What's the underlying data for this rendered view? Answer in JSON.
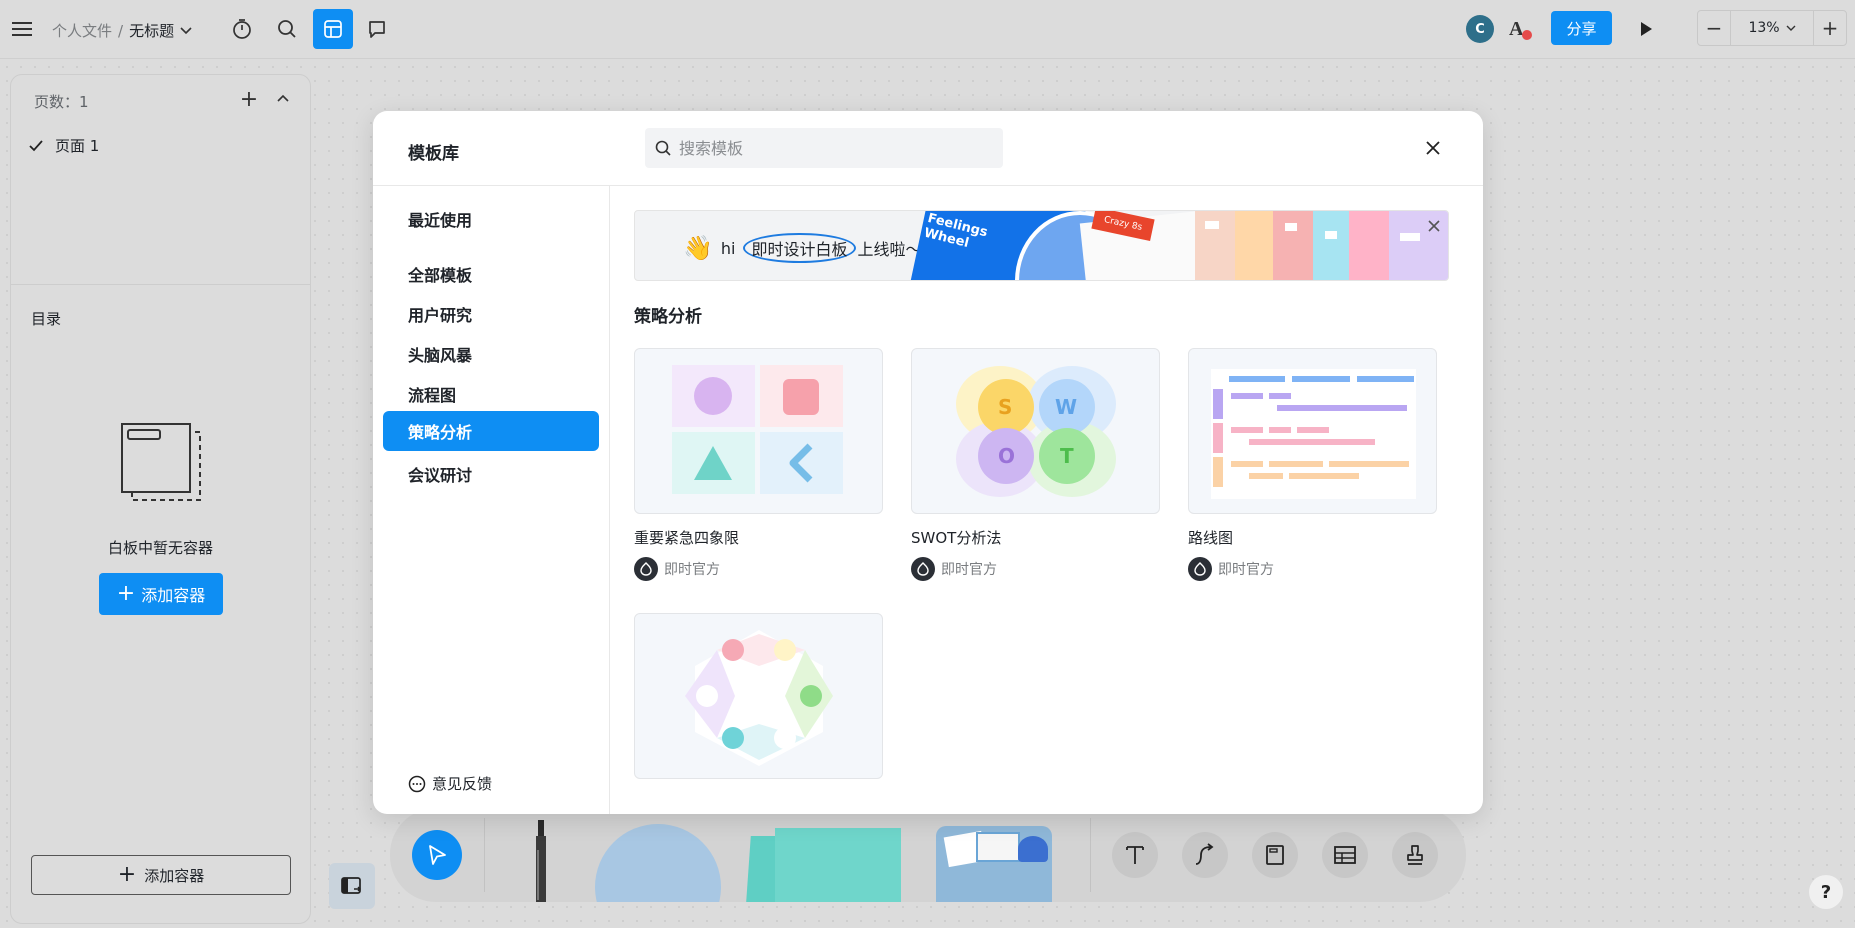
{
  "topbar": {
    "breadcrumb_root": "个人文件",
    "breadcrumb_sep": "/",
    "breadcrumb_current": "无标题",
    "avatar_initial": "C",
    "share_label": "分享",
    "zoom_minus": "−",
    "zoom_value": "13%",
    "zoom_plus": "+"
  },
  "left_panel": {
    "pages_count_label": "页数：1",
    "page_item": "页面 1",
    "toc_title": "目录",
    "empty_text": "白板中暂无容器",
    "add_container_label": "添加容器",
    "add_container_bottom_label": "添加容器"
  },
  "modal": {
    "title": "模板库",
    "search_placeholder": "搜索模板",
    "categories": [
      {
        "label": "最近使用"
      },
      {
        "label": "全部模板"
      },
      {
        "label": "用户研究"
      },
      {
        "label": "头脑风暴"
      },
      {
        "label": "流程图"
      },
      {
        "label": "策略分析"
      },
      {
        "label": "会议研讨"
      }
    ],
    "active_category": "策略分析",
    "feedback_label": "意见反馈",
    "banner": {
      "greeting": "hi",
      "highlight": "即时设计白板",
      "suffix": "上线啦～",
      "feelings_wheel": "Feelings Wheel",
      "crazy": "Crazy 8s"
    },
    "section_title": "策略分析",
    "templates": [
      {
        "name": "重要紧急四象限",
        "author": "即时官方"
      },
      {
        "name": "SWOT分析法",
        "author": "即时官方",
        "letters": [
          "S",
          "W",
          "O",
          "T"
        ]
      },
      {
        "name": "路线图",
        "author": "即时官方"
      },
      {
        "name": "",
        "author": ""
      }
    ]
  },
  "help_label": "?",
  "colors": {
    "accent": "#0e8ef3",
    "canvas": "#dcdcdc",
    "modal_bg": "#ffffff"
  }
}
